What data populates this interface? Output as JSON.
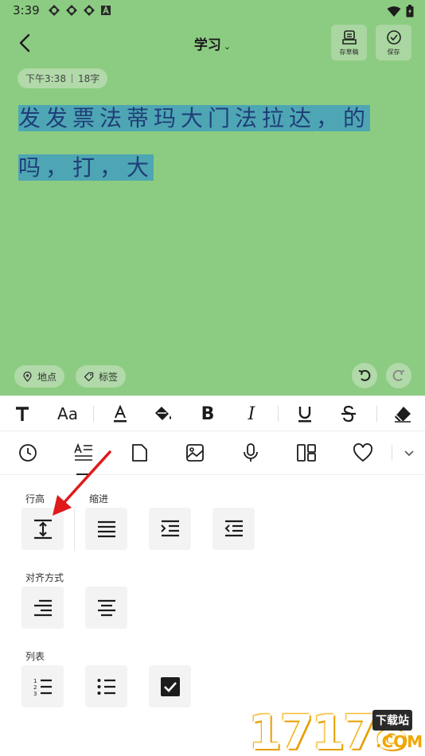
{
  "status_bar": {
    "time": "3:39"
  },
  "header": {
    "title": "学习",
    "draft_label": "存草稿",
    "save_label": "保存"
  },
  "meta": {
    "time": "下午3:38",
    "word_count": "18字"
  },
  "note": {
    "line1": "发发票法蒂玛大门法拉达，的",
    "line2": "吗，打，大"
  },
  "chips": {
    "location": "地点",
    "tags": "标签"
  },
  "format_toolbar": {
    "items": [
      "bold-T",
      "font-size-Aa",
      "text-color",
      "fill-color",
      "bold",
      "italic",
      "underline",
      "strikethrough",
      "eraser"
    ],
    "font_size_label": "Aa",
    "bold_label": "B",
    "italic_label": "I"
  },
  "tool_row": {
    "items": [
      "clock",
      "paragraph-format",
      "page",
      "image",
      "microphone",
      "layout",
      "heart",
      "expand"
    ],
    "active": "paragraph-format"
  },
  "panel": {
    "line_height_label": "行高",
    "indent_label": "缩进",
    "align_label": "对齐方式",
    "list_label": "列表"
  },
  "watermark": {
    "digits": "17178",
    "tag": "下载站",
    "com": ".COM"
  },
  "colors": {
    "note_bg": "#8ccc82",
    "highlight": "#4ea6b4",
    "note_text": "#1f3f78",
    "arrow": "#e0191b"
  }
}
